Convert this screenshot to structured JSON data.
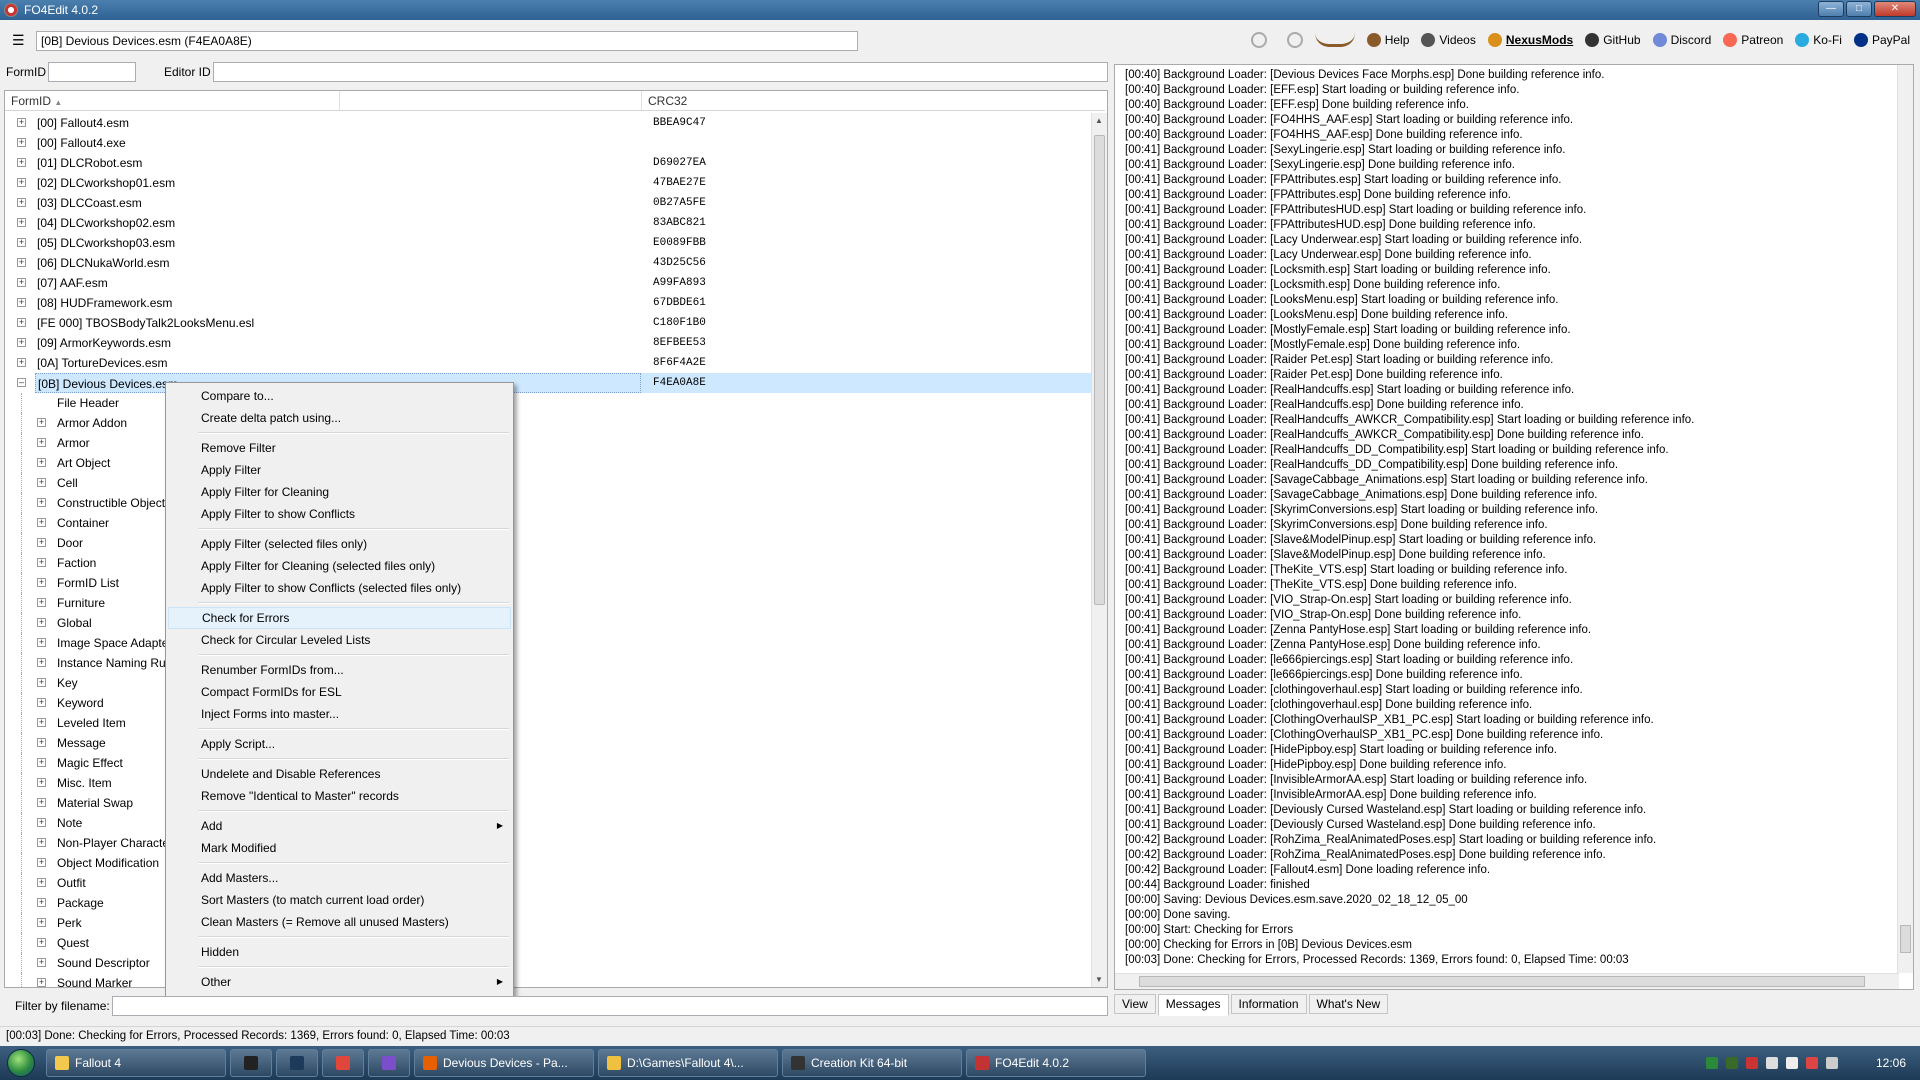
{
  "window": {
    "title": "FO4Edit 4.0.2"
  },
  "toolbar": {
    "path": "[0B] Devious Devices.esm (F4EA0A8E)",
    "links": [
      {
        "label": "Help",
        "icon": "help-icon",
        "color": "#8b5a2b"
      },
      {
        "label": "Videos",
        "icon": "videos-icon",
        "color": "#555555"
      },
      {
        "label": "NexusMods",
        "icon": "nexusmods-icon",
        "color": "#d98f1a"
      },
      {
        "label": "GitHub",
        "icon": "github-icon",
        "color": "#333333"
      },
      {
        "label": "Discord",
        "icon": "discord-icon",
        "color": "#7289da"
      },
      {
        "label": "Patreon",
        "icon": "patreon-icon",
        "color": "#f96854"
      },
      {
        "label": "Ko-Fi",
        "icon": "kofi-icon",
        "color": "#29abe0"
      },
      {
        "label": "PayPal",
        "icon": "paypal-icon",
        "color": "#003087"
      }
    ]
  },
  "fields": {
    "formid_label": "FormID",
    "editorid_label": "Editor ID"
  },
  "tree": {
    "headers": {
      "formid": "FormID",
      "crc": "CRC32"
    },
    "files": [
      {
        "name": "[00] Fallout4.esm",
        "crc": "BBEA9C47",
        "expanded": false
      },
      {
        "name": "[00] Fallout4.exe",
        "crc": "",
        "expanded": false
      },
      {
        "name": "[01] DLCRobot.esm",
        "crc": "D69027EA",
        "expanded": false
      },
      {
        "name": "[02] DLCworkshop01.esm",
        "crc": "47BAE27E",
        "expanded": false
      },
      {
        "name": "[03] DLCCoast.esm",
        "crc": "0B27A5FE",
        "expanded": false
      },
      {
        "name": "[04] DLCworkshop02.esm",
        "crc": "83ABC821",
        "expanded": false
      },
      {
        "name": "[05] DLCworkshop03.esm",
        "crc": "E0089FBB",
        "expanded": false
      },
      {
        "name": "[06] DLCNukaWorld.esm",
        "crc": "43D25C56",
        "expanded": false
      },
      {
        "name": "[07] AAF.esm",
        "crc": "A99FA893",
        "expanded": false
      },
      {
        "name": "[08] HUDFramework.esm",
        "crc": "67DBDE61",
        "expanded": false
      },
      {
        "name": "[FE 000] TBOSBodyTalk2LooksMenu.esl",
        "crc": "C180F1B0",
        "expanded": false
      },
      {
        "name": "[09] ArmorKeywords.esm",
        "crc": "8EFBEE53",
        "expanded": false
      },
      {
        "name": "[0A] TortureDevices.esm",
        "crc": "8F6F4A2E",
        "expanded": false
      },
      {
        "name": "[0B] Devious Devices.esm",
        "crc": "F4EA0A8E",
        "expanded": true,
        "selected": true
      }
    ],
    "children": [
      "File Header",
      "Armor Addon",
      "Armor",
      "Art Object",
      "Cell",
      "Constructible Object",
      "Container",
      "Door",
      "Faction",
      "FormID List",
      "Furniture",
      "Global",
      "Image Space Adapter",
      "Instance Naming Rules",
      "Key",
      "Keyword",
      "Leveled Item",
      "Message",
      "Magic Effect",
      "Misc. Item",
      "Material Swap",
      "Note",
      "Non-Player Character",
      "Object Modification",
      "Outfit",
      "Package",
      "Perk",
      "Quest",
      "Sound Descriptor",
      "Sound Marker"
    ]
  },
  "context_menu": [
    {
      "label": "Compare to..."
    },
    {
      "label": "Create delta patch using..."
    },
    {
      "sep": true
    },
    {
      "label": "Remove Filter"
    },
    {
      "label": "Apply Filter"
    },
    {
      "label": "Apply Filter for Cleaning"
    },
    {
      "label": "Apply Filter to show Conflicts"
    },
    {
      "sep": true
    },
    {
      "label": "Apply Filter (selected files only)"
    },
    {
      "label": "Apply Filter for Cleaning (selected files only)"
    },
    {
      "label": "Apply Filter to show Conflicts (selected files only)"
    },
    {
      "sep": true
    },
    {
      "label": "Check for Errors",
      "highlight": true
    },
    {
      "label": "Check for Circular Leveled Lists"
    },
    {
      "sep": true
    },
    {
      "label": "Renumber FormIDs from..."
    },
    {
      "label": "Compact FormIDs for ESL"
    },
    {
      "label": "Inject Forms into master..."
    },
    {
      "sep": true
    },
    {
      "label": "Apply Script..."
    },
    {
      "sep": true
    },
    {
      "label": "Undelete and Disable References"
    },
    {
      "label": "Remove \"Identical to Master\" records"
    },
    {
      "sep": true
    },
    {
      "label": "Add",
      "submenu": true
    },
    {
      "label": "Mark Modified"
    },
    {
      "sep": true
    },
    {
      "label": "Add Masters..."
    },
    {
      "label": "Sort Masters (to match current load order)"
    },
    {
      "label": "Clean Masters (= Remove all unused Masters)"
    },
    {
      "sep": true
    },
    {
      "label": "Hidden"
    },
    {
      "sep": true
    },
    {
      "label": "Other",
      "submenu": true
    }
  ],
  "filter": {
    "label": "Filter by filename:"
  },
  "log": [
    "[00:40] Background Loader: [Devious Devices Face Morphs.esp] Done building reference info.",
    "[00:40] Background Loader: [EFF.esp] Start loading or building reference info.",
    "[00:40] Background Loader: [EFF.esp] Done building reference info.",
    "[00:40] Background Loader: [FO4HHS_AAF.esp] Start loading or building reference info.",
    "[00:40] Background Loader: [FO4HHS_AAF.esp] Done building reference info.",
    "[00:41] Background Loader: [SexyLingerie.esp] Start loading or building reference info.",
    "[00:41] Background Loader: [SexyLingerie.esp] Done building reference info.",
    "[00:41] Background Loader: [FPAttributes.esp] Start loading or building reference info.",
    "[00:41] Background Loader: [FPAttributes.esp] Done building reference info.",
    "[00:41] Background Loader: [FPAttributesHUD.esp] Start loading or building reference info.",
    "[00:41] Background Loader: [FPAttributesHUD.esp] Done building reference info.",
    "[00:41] Background Loader: [Lacy Underwear.esp] Start loading or building reference info.",
    "[00:41] Background Loader: [Lacy Underwear.esp] Done building reference info.",
    "[00:41] Background Loader: [Locksmith.esp] Start loading or building reference info.",
    "[00:41] Background Loader: [Locksmith.esp] Done building reference info.",
    "[00:41] Background Loader: [LooksMenu.esp] Start loading or building reference info.",
    "[00:41] Background Loader: [LooksMenu.esp] Done building reference info.",
    "[00:41] Background Loader: [MostlyFemale.esp] Start loading or building reference info.",
    "[00:41] Background Loader: [MostlyFemale.esp] Done building reference info.",
    "[00:41] Background Loader: [Raider Pet.esp] Start loading or building reference info.",
    "[00:41] Background Loader: [Raider Pet.esp] Done building reference info.",
    "[00:41] Background Loader: [RealHandcuffs.esp] Start loading or building reference info.",
    "[00:41] Background Loader: [RealHandcuffs.esp] Done building reference info.",
    "[00:41] Background Loader: [RealHandcuffs_AWKCR_Compatibility.esp] Start loading or building reference info.",
    "[00:41] Background Loader: [RealHandcuffs_AWKCR_Compatibility.esp] Done building reference info.",
    "[00:41] Background Loader: [RealHandcuffs_DD_Compatibility.esp] Start loading or building reference info.",
    "[00:41] Background Loader: [RealHandcuffs_DD_Compatibility.esp] Done building reference info.",
    "[00:41] Background Loader: [SavageCabbage_Animations.esp] Start loading or building reference info.",
    "[00:41] Background Loader: [SavageCabbage_Animations.esp] Done building reference info.",
    "[00:41] Background Loader: [SkyrimConversions.esp] Start loading or building reference info.",
    "[00:41] Background Loader: [SkyrimConversions.esp] Done building reference info.",
    "[00:41] Background Loader: [Slave&ModelPinup.esp] Start loading or building reference info.",
    "[00:41] Background Loader: [Slave&ModelPinup.esp] Done building reference info.",
    "[00:41] Background Loader: [TheKite_VTS.esp] Start loading or building reference info.",
    "[00:41] Background Loader: [TheKite_VTS.esp] Done building reference info.",
    "[00:41] Background Loader: [VIO_Strap-On.esp] Start loading or building reference info.",
    "[00:41] Background Loader: [VIO_Strap-On.esp] Done building reference info.",
    "[00:41] Background Loader: [Zenna PantyHose.esp] Start loading or building reference info.",
    "[00:41] Background Loader: [Zenna PantyHose.esp] Done building reference info.",
    "[00:41] Background Loader: [le666piercings.esp] Start loading or building reference info.",
    "[00:41] Background Loader: [le666piercings.esp] Done building reference info.",
    "[00:41] Background Loader: [clothingoverhaul.esp] Start loading or building reference info.",
    "[00:41] Background Loader: [clothingoverhaul.esp] Done building reference info.",
    "[00:41] Background Loader: [ClothingOverhaulSP_XB1_PC.esp] Start loading or building reference info.",
    "[00:41] Background Loader: [ClothingOverhaulSP_XB1_PC.esp] Done building reference info.",
    "[00:41] Background Loader: [HidePipboy.esp] Start loading or building reference info.",
    "[00:41] Background Loader: [HidePipboy.esp] Done building reference info.",
    "[00:41] Background Loader: [InvisibleArmorAA.esp] Start loading or building reference info.",
    "[00:41] Background Loader: [InvisibleArmorAA.esp] Done building reference info.",
    "[00:41] Background Loader: [Deviously Cursed Wasteland.esp] Start loading or building reference info.",
    "[00:41] Background Loader: [Deviously Cursed Wasteland.esp] Done building reference info.",
    "[00:42] Background Loader: [RohZima_RealAnimatedPoses.esp] Start loading or building reference info.",
    "[00:42] Background Loader: [RohZima_RealAnimatedPoses.esp] Done building reference info.",
    "[00:42] Background Loader: [Fallout4.esm] Done loading reference info.",
    "[00:44] Background Loader: finished",
    "[00:00] Saving: Devious Devices.esm.save.2020_02_18_12_05_00",
    "[00:00] Done saving.",
    "[00:00] Start: Checking for Errors",
    "[00:00] Checking for Errors in [0B] Devious Devices.esm",
    "[00:03] Done: Checking for Errors, Processed Records: 1369, Errors found: 0, Elapsed Time: 00:03"
  ],
  "tabs": [
    {
      "label": "View"
    },
    {
      "label": "Messages",
      "active": true
    },
    {
      "label": "Information"
    },
    {
      "label": "What's New"
    }
  ],
  "status": "[00:03] Done: Checking for Errors, Processed Records: 1369, Errors found: 0, Elapsed Time: 00:03",
  "taskbar": {
    "items": [
      {
        "label": "Fallout 4",
        "icon": "fallout4-icon",
        "color": "#f2c94c"
      },
      {
        "label": "",
        "icon": "console-icon",
        "color": "#222222",
        "small": true
      },
      {
        "label": "",
        "icon": "arrow-icon",
        "color": "#1e3a5a",
        "small": true
      },
      {
        "label": "",
        "icon": "chrome-icon",
        "color": "#e0463a",
        "small": true
      },
      {
        "label": "",
        "icon": "visual-studio-icon",
        "color": "#7b4fc9",
        "small": true
      },
      {
        "label": "Devious Devices - Pa...",
        "icon": "firefox-icon",
        "color": "#e66000"
      },
      {
        "label": "D:\\Games\\Fallout 4\\...",
        "icon": "folder-icon",
        "color": "#f0c040"
      },
      {
        "label": "Creation Kit 64-bit",
        "icon": "creation-kit-icon",
        "color": "#333333"
      },
      {
        "label": "FO4Edit 4.0.2",
        "icon": "fo4edit-icon",
        "color": "#c33333"
      }
    ],
    "clock": "12:06"
  }
}
